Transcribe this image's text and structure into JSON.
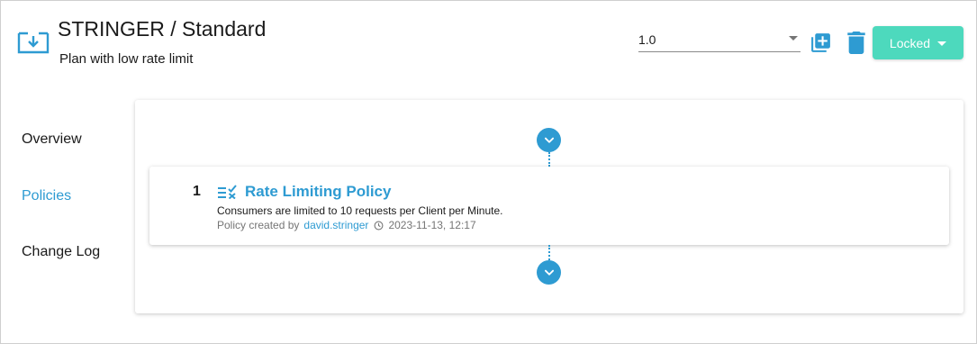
{
  "header": {
    "title": "STRINGER / Standard",
    "subtitle": "Plan with low rate limit",
    "plan_icon": "plan-import-icon",
    "version": {
      "selected": "1.0",
      "icon": "chevron-down-icon"
    },
    "actions": {
      "new_version_icon": "library-add-icon",
      "delete_icon": "trash-icon",
      "status_button_label": "Locked"
    }
  },
  "sidebar": {
    "items": [
      {
        "label": "Overview",
        "active": false
      },
      {
        "label": "Policies",
        "active": true
      },
      {
        "label": "Change Log",
        "active": false
      }
    ]
  },
  "policies": {
    "list": [
      {
        "index": "1",
        "icon": "rate-limit-icon",
        "name": "Rate Limiting Policy",
        "description": "Consumers are limited to 10 requests per Client per Minute.",
        "created_by_label": "Policy created by",
        "author": "david.stringer",
        "timestamp": "2023-11-13, 12:17"
      }
    ]
  },
  "colors": {
    "accent": "#2e9bd2",
    "locked_button": "#4dd9bd",
    "text": "#1a1a1a",
    "muted": "#757575"
  }
}
